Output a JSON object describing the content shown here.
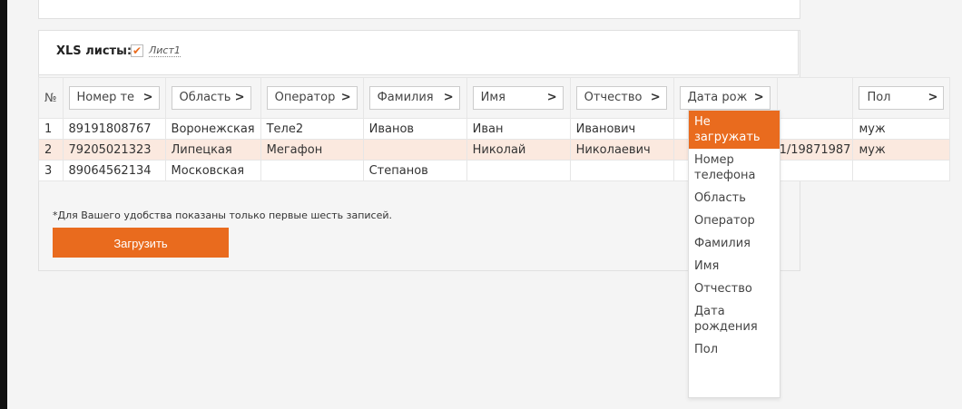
{
  "sheets": {
    "label": "XLS листы:",
    "check_mark": "✔",
    "items": [
      "Лист1"
    ]
  },
  "table": {
    "num_header": "№",
    "columns": [
      "Номер те",
      "Область",
      "Оператор",
      "Фамилия",
      "Имя",
      "Отчество",
      "Дата рож",
      "",
      "Пол"
    ],
    "arrow": ">",
    "rows": [
      [
        "1",
        "89191808767",
        "Воронежская",
        "Теле2",
        "Иванов",
        "Иван",
        "Иванович",
        "",
        "",
        "муж"
      ],
      [
        "2",
        "79205021323",
        "Липецкая",
        "Мегафон",
        "",
        "Николай",
        "Николаевич",
        "",
        "1/19871987",
        "муж"
      ],
      [
        "3",
        "89064562134",
        "Московская",
        "",
        "Степанов",
        "",
        "",
        "",
        "",
        ""
      ]
    ]
  },
  "note": "*Для Вашего удобства показаны только первые шесть записей.",
  "upload_button": "Загрузить",
  "dropdown": {
    "selected": "Не загружать",
    "options": [
      "Не загружать",
      "Номер телефона",
      "Область",
      "Оператор",
      "Фамилия",
      "Имя",
      "Отчество",
      "Дата рождения",
      "Пол"
    ]
  },
  "colors": {
    "accent": "#e96b1e",
    "row_highlight": "#fbe9df"
  }
}
